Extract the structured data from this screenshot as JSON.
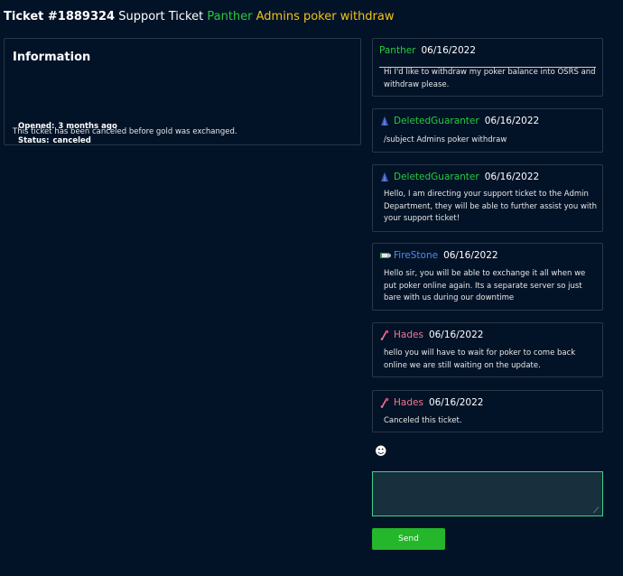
{
  "header": {
    "ticket_id": "Ticket #1889324",
    "type": "Support Ticket",
    "username": "Panther",
    "subject": "Admins poker withdraw"
  },
  "info": {
    "title": "Information",
    "opened_label": "Opened:",
    "opened_value": "3 months ago",
    "status_label": "Status:",
    "status_value": "canceled",
    "note": "This ticket has been canceled before gold was exchanged."
  },
  "messages": [
    {
      "user": "Panther",
      "date": "06/16/2022",
      "color": "#27c93f",
      "icon": "none",
      "text": "Hi I'd like to withdraw my poker balance into OSRS and withdraw please."
    },
    {
      "user": "DeletedGuaranter",
      "date": "06/16/2022",
      "color": "#27c93f",
      "icon": "wizard-hat-icon",
      "text": "/subject Admins poker withdraw"
    },
    {
      "user": "DeletedGuaranter",
      "date": "06/16/2022",
      "color": "#27c93f",
      "icon": "wizard-hat-icon",
      "text": "Hello, I am directing your support ticket to the Admin Department, they will be able to further assist you with your support ticket!"
    },
    {
      "user": "FireStone",
      "date": "06/16/2022",
      "color": "#4a8cf0",
      "icon": "rank-badge-icon",
      "text": "Hello sir, you will be able to exchange it all when we put poker online again. Its a separate server so just bare with us during our downtime"
    },
    {
      "user": "Hades",
      "date": "06/16/2022",
      "color": "#f07896",
      "icon": "staff-icon",
      "text": "hello you will have to wait for poker to come back online we are still waiting on the update."
    },
    {
      "user": "Hades",
      "date": "06/16/2022",
      "color": "#f07896",
      "icon": "staff-icon",
      "text": "Canceled this ticket."
    }
  ],
  "reply": {
    "value": "",
    "send_label": "Send"
  },
  "colors": {
    "background": "#031327",
    "accent_green": "#24b62b",
    "subject_yellow": "#f1c21b"
  }
}
